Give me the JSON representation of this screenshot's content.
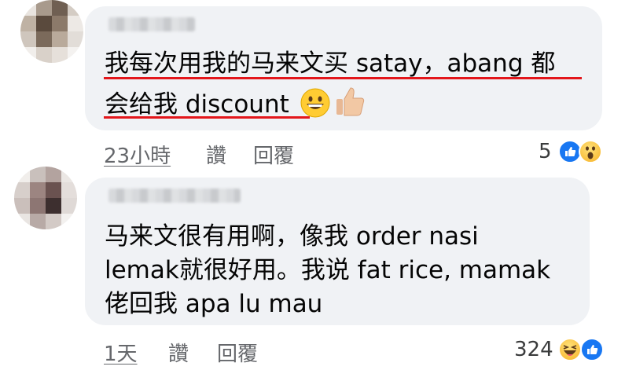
{
  "comments": [
    {
      "lines": [
        "我每次用我的马来文买 satay，abang 都",
        "会给我 discount"
      ],
      "time": "23小時",
      "like_label": "讚",
      "reply_label": "回覆",
      "reaction_count": "5",
      "reactions": [
        "like-icon",
        "wow-icon"
      ],
      "inline_emojis": [
        "grinning-face-icon",
        "thumbs-up-icon"
      ]
    },
    {
      "lines": [
        "马来文很有用啊，像我 order nasi",
        "lemak就很好用。我说 fat rice, mamak",
        "佬回我 apa lu mau"
      ],
      "time": "1天",
      "like_label": "讚",
      "reply_label": "回覆",
      "reaction_count": "324",
      "reactions": [
        "haha-icon",
        "like-icon"
      ]
    }
  ],
  "colors": {
    "bubble": "#f0f2f5",
    "underline": "#e3161b",
    "meta": "#65676b",
    "like_blue": "#1877f2"
  }
}
